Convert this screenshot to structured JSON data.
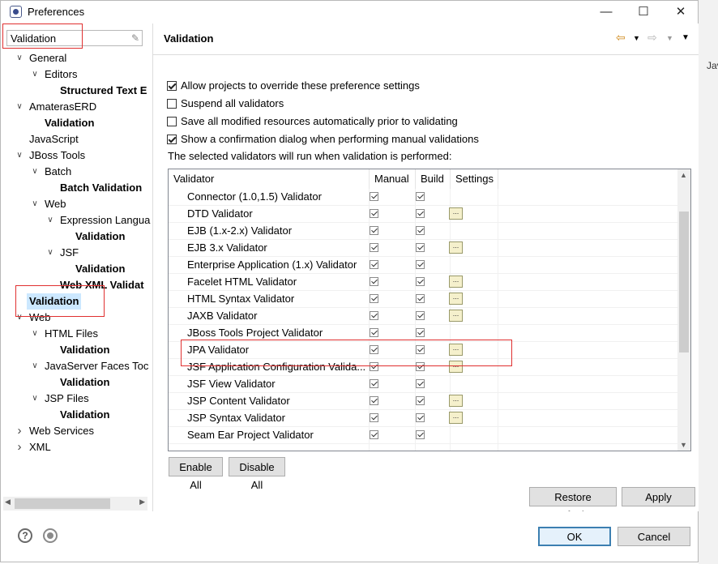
{
  "window": {
    "title": "Preferences"
  },
  "filter": {
    "value": "Validation"
  },
  "tree": [
    {
      "label": "General",
      "level": 1,
      "expander": "open",
      "bold": false
    },
    {
      "label": "Editors",
      "level": 2,
      "expander": "open",
      "bold": false
    },
    {
      "label": "Structured Text E",
      "level": 3,
      "expander": "none",
      "bold": true
    },
    {
      "label": "AmaterasERD",
      "level": 1,
      "expander": "open",
      "bold": false
    },
    {
      "label": "Validation",
      "level": 2,
      "expander": "none",
      "bold": true
    },
    {
      "label": "JavaScript",
      "level": 1,
      "expander": "none",
      "bold": false
    },
    {
      "label": "JBoss Tools",
      "level": 1,
      "expander": "open",
      "bold": false
    },
    {
      "label": "Batch",
      "level": 2,
      "expander": "open",
      "bold": false
    },
    {
      "label": "Batch Validation",
      "level": 3,
      "expander": "none",
      "bold": true
    },
    {
      "label": "Web",
      "level": 2,
      "expander": "open",
      "bold": false
    },
    {
      "label": "Expression Langua",
      "level": 3,
      "expander": "open",
      "bold": false
    },
    {
      "label": "Validation",
      "level": 4,
      "expander": "none",
      "bold": true
    },
    {
      "label": "JSF",
      "level": 3,
      "expander": "open",
      "bold": false
    },
    {
      "label": "Validation",
      "level": 4,
      "expander": "none",
      "bold": true
    },
    {
      "label": "Web XML Validat",
      "level": 3,
      "expander": "none",
      "bold": true
    },
    {
      "label": "Validation",
      "level": 1,
      "expander": "none",
      "bold": true,
      "selected": true
    },
    {
      "label": "Web",
      "level": 1,
      "expander": "open",
      "bold": false
    },
    {
      "label": "HTML Files",
      "level": 2,
      "expander": "open",
      "bold": false
    },
    {
      "label": "Validation",
      "level": 3,
      "expander": "none",
      "bold": true
    },
    {
      "label": "JavaServer Faces Toc",
      "level": 2,
      "expander": "open",
      "bold": false
    },
    {
      "label": "Validation",
      "level": 3,
      "expander": "none",
      "bold": true
    },
    {
      "label": "JSP Files",
      "level": 2,
      "expander": "open",
      "bold": false
    },
    {
      "label": "Validation",
      "level": 3,
      "expander": "none",
      "bold": true
    },
    {
      "label": "Web Services",
      "level": 1,
      "expander": "closed",
      "bold": false
    },
    {
      "label": "XML",
      "level": 1,
      "expander": "closed",
      "bold": false
    }
  ],
  "page": {
    "title": "Validation",
    "options": [
      {
        "label": "Allow projects to override these preference settings",
        "checked": true
      },
      {
        "label": "Suspend all validators",
        "checked": false
      },
      {
        "label": "Save all modified resources automatically prior to validating",
        "checked": false
      },
      {
        "label": "Show a confirmation dialog when performing manual validations",
        "checked": true
      }
    ],
    "info": "The selected validators will run when validation is performed:",
    "columns": {
      "validator": "Validator",
      "manual": "Manual",
      "build": "Build",
      "settings": "Settings"
    },
    "validators": [
      {
        "name": "Connector (1.0,1.5) Validator",
        "manual": true,
        "build": true,
        "settings": false
      },
      {
        "name": "DTD Validator",
        "manual": true,
        "build": true,
        "settings": true
      },
      {
        "name": "EJB (1.x-2.x) Validator",
        "manual": true,
        "build": true,
        "settings": false
      },
      {
        "name": "EJB 3.x Validator",
        "manual": true,
        "build": true,
        "settings": true
      },
      {
        "name": "Enterprise Application (1.x) Validator",
        "manual": true,
        "build": true,
        "settings": false
      },
      {
        "name": "Facelet HTML Validator",
        "manual": true,
        "build": true,
        "settings": true
      },
      {
        "name": "HTML Syntax Validator",
        "manual": true,
        "build": true,
        "settings": true
      },
      {
        "name": "JAXB Validator",
        "manual": true,
        "build": true,
        "settings": true
      },
      {
        "name": "JBoss Tools Project Validator",
        "manual": true,
        "build": true,
        "settings": false
      },
      {
        "name": "JPA Validator",
        "manual": true,
        "build": true,
        "settings": true
      },
      {
        "name": "JSF Application Configuration Valida...",
        "manual": true,
        "build": true,
        "settings": true
      },
      {
        "name": "JSF View Validator",
        "manual": true,
        "build": true,
        "settings": false
      },
      {
        "name": "JSP Content Validator",
        "manual": true,
        "build": true,
        "settings": true
      },
      {
        "name": "JSP Syntax Validator",
        "manual": true,
        "build": true,
        "settings": true
      },
      {
        "name": "Seam Ear Project Validator",
        "manual": true,
        "build": true,
        "settings": false
      }
    ],
    "enable_all": "Enable All",
    "disable_all": "Disable All",
    "restore_defaults": "Restore Defaults",
    "apply": "Apply"
  },
  "buttons": {
    "ok": "OK",
    "cancel": "Cancel"
  },
  "background": {
    "tab_text": "Jav"
  }
}
